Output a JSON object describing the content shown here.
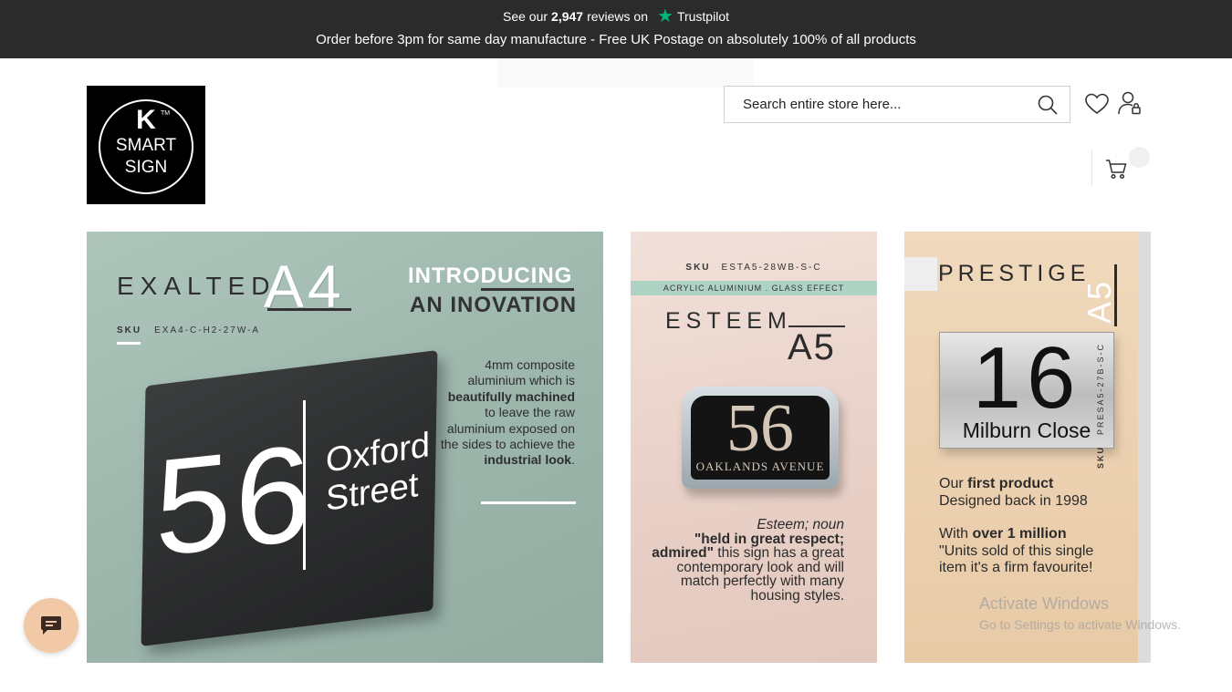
{
  "announcement": {
    "reviews_prefix": "See our",
    "reviews_count": "2,947",
    "reviews_suffix": "reviews on",
    "trustpilot_label": "Trustpilot",
    "order_line": "Order before 3pm for same day manufacture - Free UK Postage on absolutely 100% of all products"
  },
  "logo": {
    "letter": "K",
    "tm": "TM",
    "word1": "SMART",
    "word2": "SIGN"
  },
  "header": {
    "search_placeholder": "Search entire store here...",
    "icons": [
      "search-icon",
      "heart-icon",
      "account-icon",
      "cart-icon"
    ]
  },
  "banners": {
    "exalted": {
      "title": "EXALTED",
      "size": "A4",
      "intro1": "INTRODUCING",
      "intro2": "AN INOVATION",
      "sku_label": "SKU",
      "sku": "EXA4-C-H2-27W-A",
      "desc_1": "4mm composite aluminium which is",
      "desc_2": "beautifully machined",
      "desc_3": "to leave the raw aluminium exposed on the sides to achieve the",
      "desc_4": "industrial look",
      "desc_5": ".",
      "sign_number": "56",
      "sign_street1": "Oxford",
      "sign_street2": "Street"
    },
    "esteem": {
      "sku_label": "SKU",
      "sku": "ESTA5-28WB-S-C",
      "strip": "ACRYLIC ALUMINIUM . GLASS EFFECT",
      "title": "ESTEEM",
      "size": "A5",
      "sign_number": "56",
      "sign_street": "OAKLANDS AVENUE",
      "desc_italic": "Esteem; noun",
      "desc_bold": "\"held in great respect; admired\"",
      "desc_rest": "this sign has a great contemporary look and will match perfectly with many housing styles."
    },
    "prestige": {
      "title": "PRESTIGE",
      "size": "A5",
      "sign_number": "16",
      "sign_street": "Milburn Close",
      "text1_a": "Our",
      "text1_b": "first product",
      "text1_c": "Designed back in 1998",
      "text2_a": "With",
      "text2_b": "over 1 million",
      "text2_c": "\"Units sold of this single item it's a firm favourite!",
      "sku_label": "SKU",
      "sku": "PRESA5-27B-S-C"
    }
  },
  "watermark": {
    "line1": "Activate Windows",
    "line2": "Go to Settings to activate Windows."
  },
  "colors": {
    "topbar": "#2b2b2b",
    "trustpilot_star": "#00b67a",
    "chat_button": "#f2c9a6"
  }
}
